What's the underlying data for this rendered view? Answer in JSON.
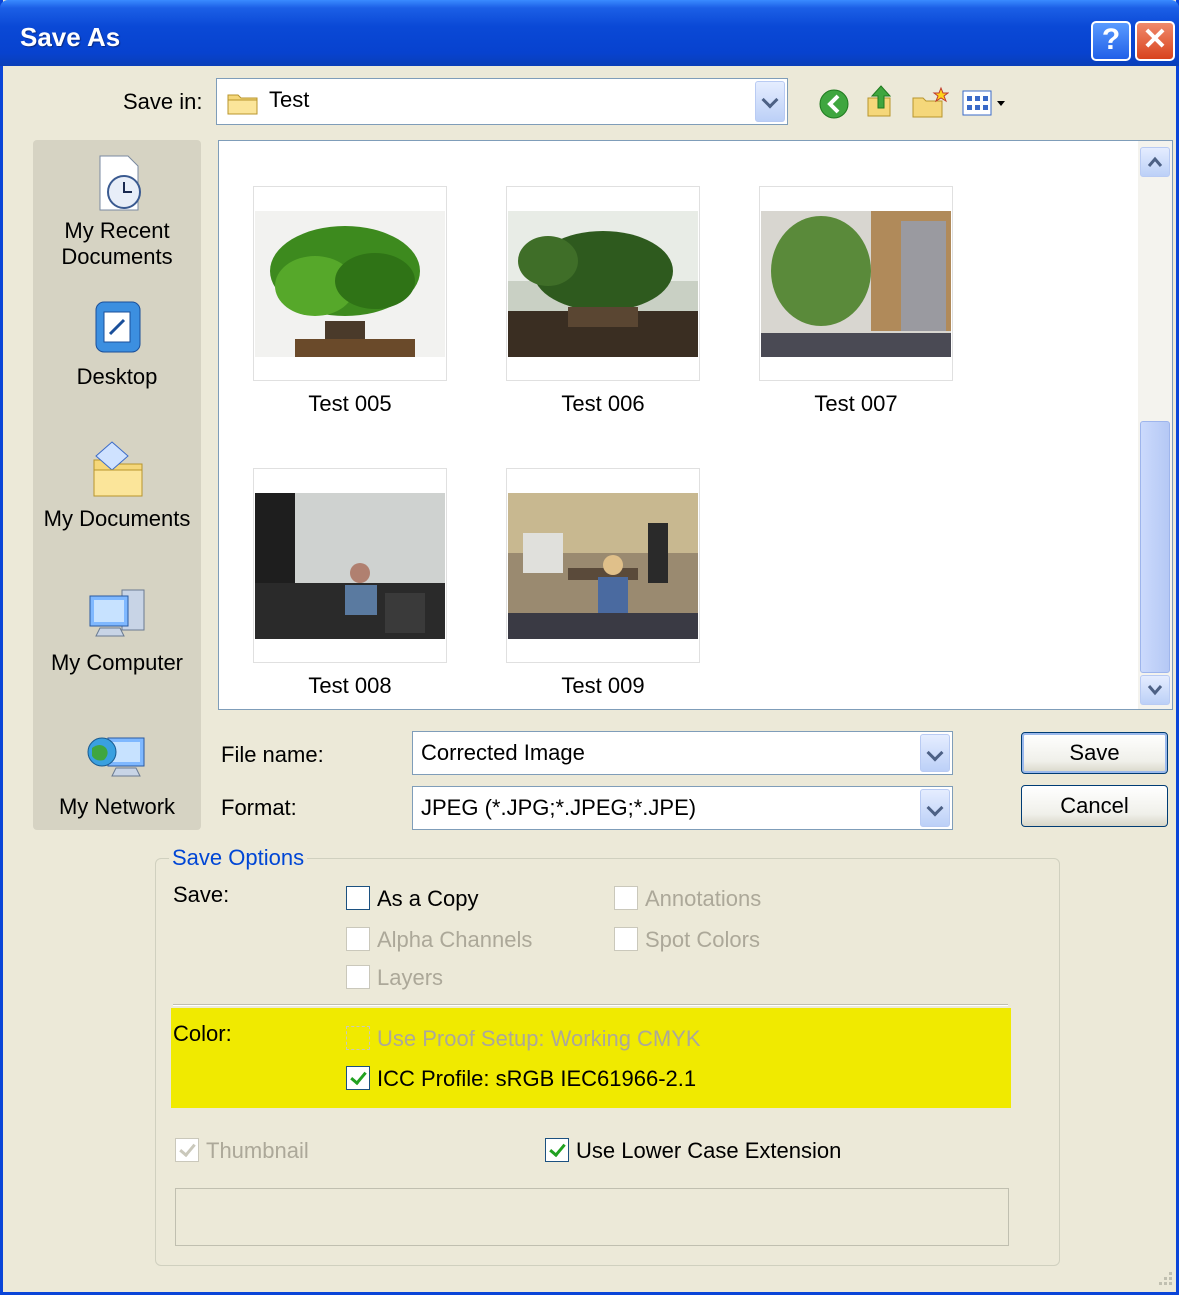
{
  "window": {
    "title": "Save As"
  },
  "title_buttons": {
    "help": "?",
    "close": "✕"
  },
  "save_in": {
    "label": "Save in:",
    "value": "Test"
  },
  "toolbar": {
    "icons": [
      "back-icon",
      "up-folder-icon",
      "new-folder-icon",
      "views-menu-icon"
    ]
  },
  "places": [
    {
      "label": "My Recent Documents",
      "icon": "recent-documents-icon"
    },
    {
      "label": "Desktop",
      "icon": "desktop-icon"
    },
    {
      "label": "My Documents",
      "icon": "my-documents-icon"
    },
    {
      "label": "My Computer",
      "icon": "my-computer-icon"
    },
    {
      "label": "My Network",
      "icon": "my-network-icon"
    }
  ],
  "files": [
    {
      "name": "Test 005"
    },
    {
      "name": "Test 006"
    },
    {
      "name": "Test 007"
    },
    {
      "name": "Test 008"
    },
    {
      "name": "Test 009"
    }
  ],
  "file_name": {
    "label": "File name:",
    "value": "Corrected Image"
  },
  "format": {
    "label": "Format:",
    "value": "JPEG (*.JPG;*.JPEG;*.JPE)"
  },
  "buttons": {
    "save": "Save",
    "cancel": "Cancel"
  },
  "save_options": {
    "legend": "Save Options",
    "save_label": "Save:",
    "as_a_copy": "As a Copy",
    "alpha_channels": "Alpha Channels",
    "layers": "Layers",
    "annotations": "Annotations",
    "spot_colors": "Spot Colors",
    "color_label": "Color:",
    "use_proof_setup": "Use Proof Setup:  Working CMYK",
    "icc_profile": "ICC Profile:  sRGB IEC61966-2.1",
    "thumbnail": "Thumbnail",
    "use_lower_case": "Use Lower Case Extension"
  },
  "colors": {
    "title_bar": "#0a49d6",
    "highlight": "#f0ea00",
    "dialog_bg": "#ece9d8",
    "legend_text": "#0046d5"
  }
}
